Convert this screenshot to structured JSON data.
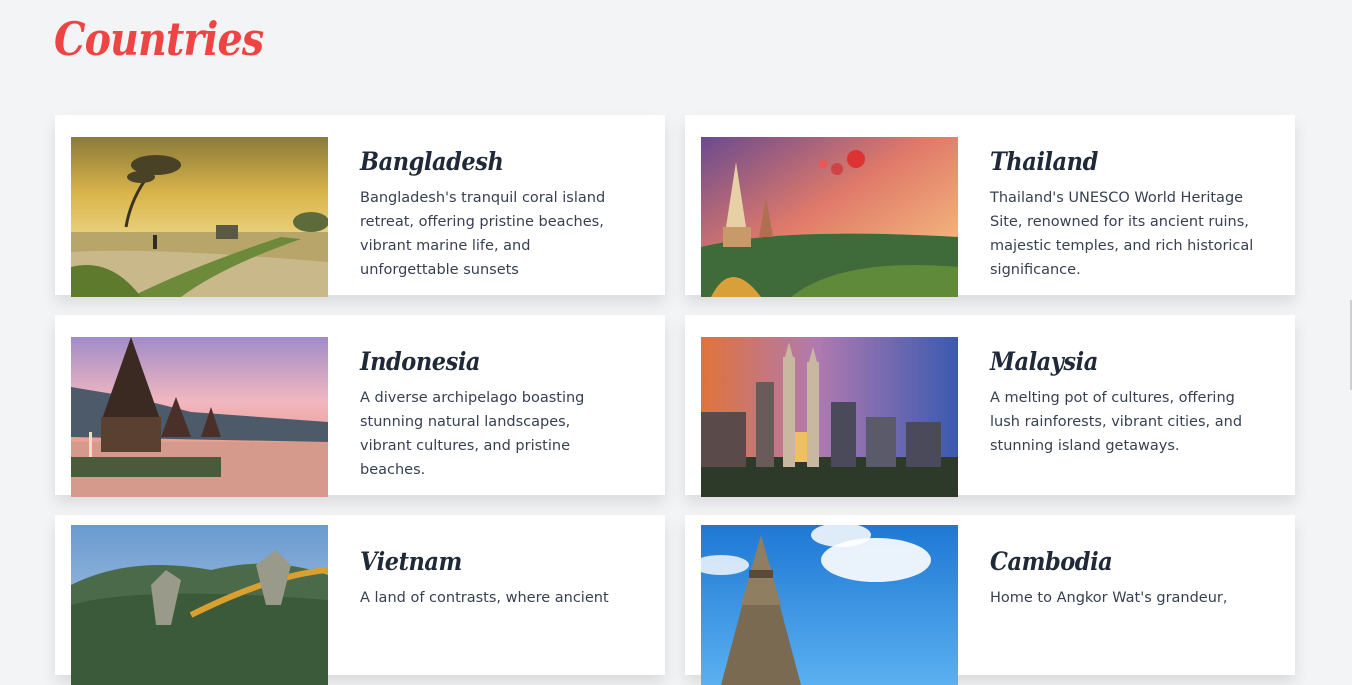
{
  "page": {
    "title": "Countries"
  },
  "countries": [
    {
      "name": "Bangladesh",
      "description": "Bangladesh's tranquil coral island retreat, offering pristine beaches, vibrant marine life, and unforgettable sunsets",
      "image_icon": "landscape-photo-icon"
    },
    {
      "name": "Thailand",
      "description": "Thailand's UNESCO World Heritage Site, renowned for its ancient ruins, majestic temples, and rich historical significance.",
      "image_icon": "temple-photo-icon"
    },
    {
      "name": "Indonesia",
      "description": "A diverse archipelago boasting stunning natural landscapes, vibrant cultures, and pristine beaches.",
      "image_icon": "pagoda-photo-icon"
    },
    {
      "name": "Malaysia",
      "description": "A melting pot of cultures, offering lush rainforests, vibrant cities, and stunning island getaways.",
      "image_icon": "skyline-photo-icon"
    },
    {
      "name": "Vietnam",
      "description": "A land of contrasts, where ancient",
      "image_icon": "golden-bridge-photo-icon"
    },
    {
      "name": "Cambodia",
      "description": "Home to Angkor Wat's grandeur,",
      "image_icon": "angkor-photo-icon"
    }
  ],
  "colors": {
    "title": "#ef4444",
    "background": "#f3f4f6",
    "card": "#ffffff"
  }
}
